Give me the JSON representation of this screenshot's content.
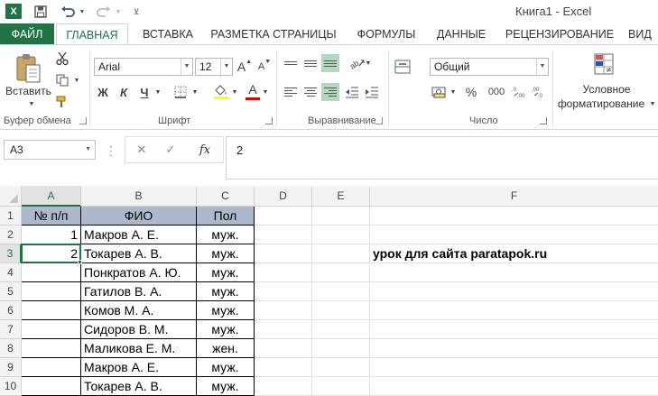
{
  "window": {
    "title": "Книга1 - Excel"
  },
  "quick_access": {
    "app_icon": "excel-logo-icon",
    "save_icon": "save-icon",
    "undo_icon": "undo-icon",
    "redo_icon": "redo-icon",
    "customize_icon": "customize-qat-icon"
  },
  "tabs": {
    "file": "ФАЙЛ",
    "home": "ГЛАВНАЯ",
    "insert": "ВСТАВКА",
    "page_layout": "РАЗМЕТКА СТРАНИЦЫ",
    "formulas": "ФОРМУЛЫ",
    "data": "ДАННЫЕ",
    "review": "РЕЦЕНЗИРОВАНИЕ",
    "view": "ВИД"
  },
  "ribbon": {
    "clipboard": {
      "label": "Буфер обмена",
      "paste": "Вставить"
    },
    "font": {
      "label": "Шрифт",
      "font_name": "Arial",
      "font_size": "12",
      "bold": "Ж",
      "italic": "К",
      "underline": "Ч",
      "grow": "A",
      "shrink": "A",
      "font_color_glyph": "A"
    },
    "alignment": {
      "label": "Выравнивание"
    },
    "number": {
      "label": "Число",
      "format": "Общий",
      "percent": "%",
      "thousands": "000"
    },
    "styles": {
      "conditional_line1": "Условное",
      "conditional_line2": "форматирование"
    }
  },
  "formula_bar": {
    "name_box": "A3",
    "cancel": "✕",
    "enter": "✓",
    "fx": "fx",
    "value": "2"
  },
  "grid": {
    "columns": [
      "A",
      "B",
      "C",
      "D",
      "E",
      "F"
    ],
    "rows": [
      "1",
      "2",
      "3",
      "4",
      "5",
      "6",
      "7",
      "8",
      "9",
      "10"
    ],
    "headers": {
      "a": "№ п/п",
      "b": "ФИО",
      "c": "Пол"
    },
    "data": [
      {
        "a": "1",
        "b": "Макров А. Е.",
        "c": "муж."
      },
      {
        "a": "2",
        "b": "Токарев А. В.",
        "c": "муж."
      },
      {
        "a": "",
        "b": "Понкратов А. Ю.",
        "c": "муж."
      },
      {
        "a": "",
        "b": "Гатилов В. А.",
        "c": "муж."
      },
      {
        "a": "",
        "b": "Комов М. А.",
        "c": "муж."
      },
      {
        "a": "",
        "b": "Сидоров В. М.",
        "c": "муж."
      },
      {
        "a": "",
        "b": "Маликова Е. М.",
        "c": "жен."
      },
      {
        "a": "",
        "b": "Макров А. Е.",
        "c": "муж."
      },
      {
        "a": "",
        "b": "Токарев А. В.",
        "c": "муж."
      }
    ],
    "note": "урок для сайта paratapok.ru",
    "active_cell": "A3",
    "colors": {
      "header_fill": "#adb9ca",
      "accent": "#217346"
    }
  }
}
